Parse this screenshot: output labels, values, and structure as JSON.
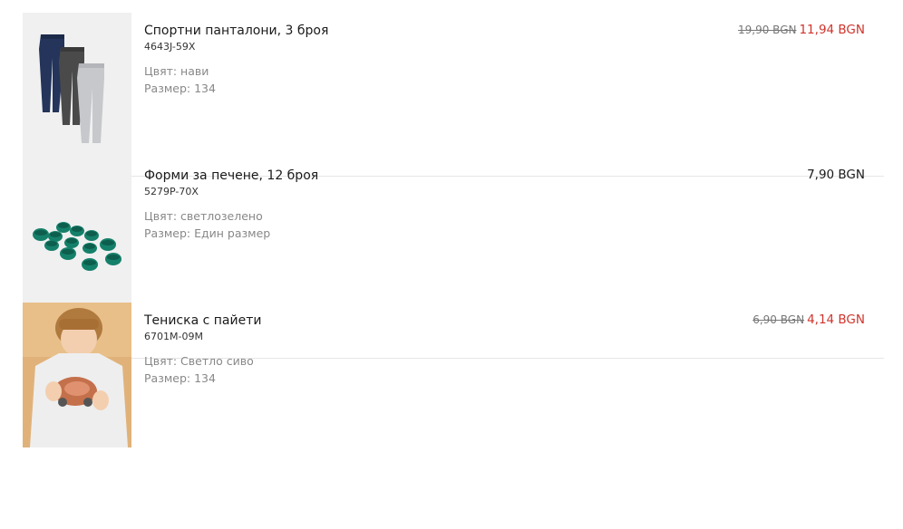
{
  "items": [
    {
      "name": "Спортни панталони, 3 броя",
      "sku": "4643J-59X",
      "color": "Цвят: нави",
      "size": "Размер: 134",
      "old_price": "19,90 BGN",
      "price": "11,94 BGN",
      "image": "sweatpants-image"
    },
    {
      "name": "Форми за печене, 12 броя",
      "sku": "5279P-70X",
      "color": "Цвят: светлозелено",
      "size": "Размер: Един размер",
      "price": "7,90 BGN",
      "image": "baking-cups-image"
    },
    {
      "name": "Тениска с пайети",
      "sku": "6701M-09M",
      "color": "Цвят: Светло сиво",
      "size": "Размер: 134",
      "old_price": "6,90 BGN",
      "price": "4,14 BGN",
      "image": "tshirt-boy-image"
    }
  ],
  "colors": {
    "sale_price": "#d0342c",
    "old_price": "#777777",
    "attribute_text": "#888888",
    "divider": "#e6e6e6",
    "thumb_bg": "#f0f0f0"
  }
}
